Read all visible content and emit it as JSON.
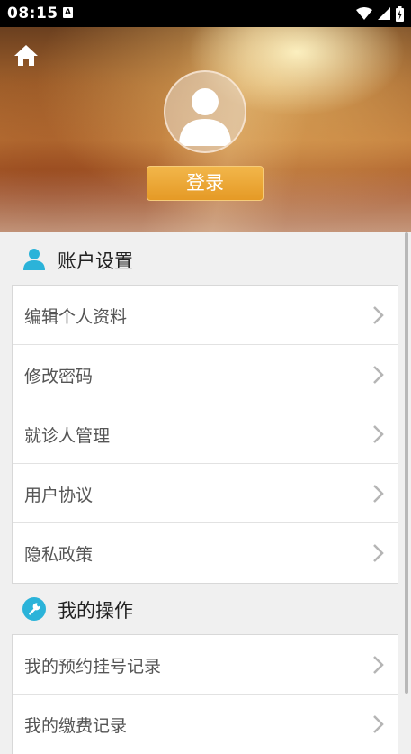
{
  "status_bar": {
    "time": "08:15",
    "a_icon": "A"
  },
  "header": {
    "login_label": "登录"
  },
  "account_section": {
    "title": "账户设置",
    "items": [
      {
        "label": "编辑个人资料"
      },
      {
        "label": "修改密码"
      },
      {
        "label": "就诊人管理"
      },
      {
        "label": "用户协议"
      },
      {
        "label": "隐私政策"
      }
    ]
  },
  "operations_section": {
    "title": "我的操作",
    "items": [
      {
        "label": "我的预约挂号记录"
      },
      {
        "label": "我的缴费记录"
      }
    ]
  },
  "colors": {
    "accent": "#2bb3d9",
    "login_button": "#e9a331",
    "status_bar": "#000000"
  },
  "icons": {
    "home": "home-icon",
    "avatar": "person-icon",
    "account": "user-icon",
    "operations": "wrench-icon",
    "chevron": "chevron-right-icon"
  }
}
